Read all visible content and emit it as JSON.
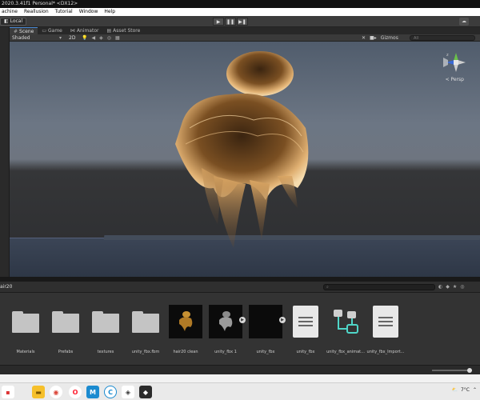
{
  "window": {
    "title": "2020.3.41f1 Personal* <DX12>"
  },
  "menu": [
    "achine",
    "Reallusion",
    "Tutorial",
    "Window",
    "Help"
  ],
  "toolbar": {
    "local_label": "Local",
    "cloud_icon": "cloud-icon"
  },
  "tabs": [
    {
      "label": "Scene",
      "icon": "scene-icon",
      "active": true
    },
    {
      "label": "Game",
      "icon": "game-icon",
      "active": false
    },
    {
      "label": "Animator",
      "icon": "animator-icon",
      "active": false
    },
    {
      "label": "Asset Store",
      "icon": "store-icon",
      "active": false
    }
  ],
  "scene_toolbar": {
    "shading": "Shaded",
    "mode_2d": "2D",
    "gizmos_label": "Gizmos",
    "search_placeholder": "All"
  },
  "viewport": {
    "perspective_label": "< Persp"
  },
  "project": {
    "breadcrumb": "air20",
    "search_placeholder": ""
  },
  "assets": [
    {
      "name": "Materials",
      "kind": "folder"
    },
    {
      "name": "Prefabs",
      "kind": "folder"
    },
    {
      "name": "textures",
      "kind": "folder"
    },
    {
      "name": "unity_fbx.fbm",
      "kind": "folder"
    },
    {
      "name": "hair20 clean",
      "kind": "model-gold"
    },
    {
      "name": "unity_fbx 1",
      "kind": "model-grey"
    },
    {
      "name": "unity_fbx",
      "kind": "model-dark"
    },
    {
      "name": "unity_fbx",
      "kind": "doc"
    },
    {
      "name": "unity_fbx_animat...",
      "kind": "animator"
    },
    {
      "name": "unity_fbx_Import...",
      "kind": "doc"
    }
  ],
  "taskbar": {
    "weather": "7°C",
    "colors": {
      "chrome": "#db4437",
      "opera": "#ff1b2d",
      "app_teal": "#1b8bd0"
    }
  }
}
